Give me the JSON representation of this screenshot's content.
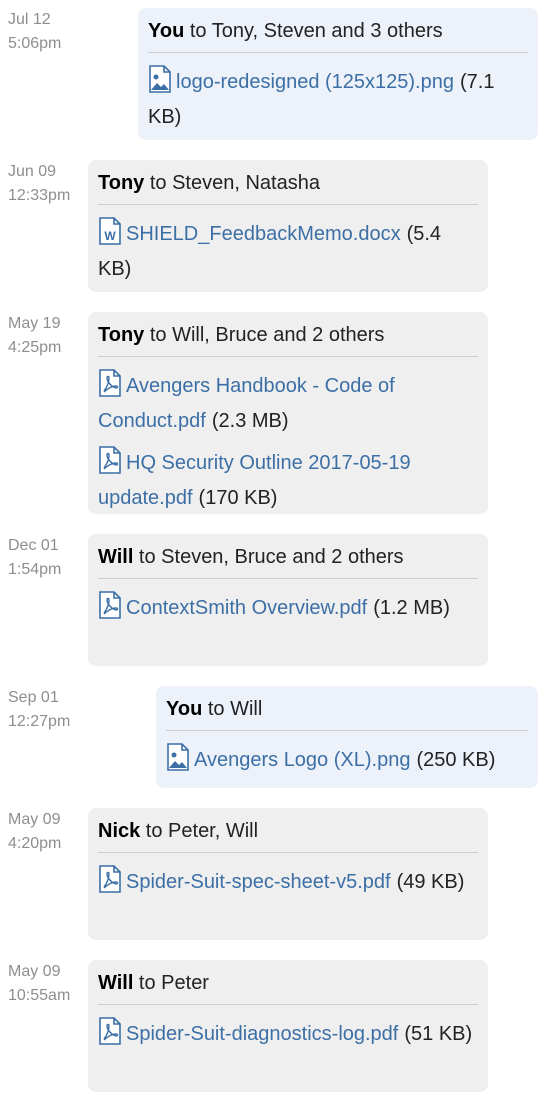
{
  "entries": [
    {
      "date": "Jul 12",
      "time": "5:06pm",
      "sender": "You",
      "recipients": " to Tony, Steven and 3 others",
      "mine": true,
      "files": [
        {
          "name": "logo-redesigned (125x125).png",
          "size": "(7.1 KB)",
          "icon": "image-file-icon"
        }
      ]
    },
    {
      "date": "Jun 09",
      "time": "12:33pm",
      "sender": "Tony",
      "recipients": " to Steven, Natasha",
      "mine": false,
      "files": [
        {
          "name": "SHIELD_FeedbackMemo.docx",
          "size": "(5.4 KB)",
          "icon": "word-file-icon"
        }
      ]
    },
    {
      "date": "May 19",
      "time": "4:25pm",
      "sender": "Tony",
      "recipients": " to Will, Bruce and 2 others",
      "mine": false,
      "files": [
        {
          "name": "Avengers Handbook - Code of Conduct.pdf",
          "size": "(2.3 MB)",
          "icon": "pdf-file-icon"
        },
        {
          "name": "HQ Security Outline 2017-05-19 update.pdf",
          "size": "(170 KB)",
          "icon": "pdf-file-icon"
        }
      ]
    },
    {
      "date": "Dec 01",
      "time": "1:54pm",
      "sender": "Will",
      "recipients": " to Steven, Bruce and 2 others",
      "mine": false,
      "files": [
        {
          "name": "ContextSmith Overview.pdf",
          "size": "(1.2 MB)",
          "icon": "pdf-file-icon"
        }
      ]
    },
    {
      "date": "Sep 01",
      "time": "12:27pm",
      "sender": "You",
      "recipients": " to Will",
      "mine": true,
      "files": [
        {
          "name": "Avengers Logo (XL).png",
          "size": "(250 KB)",
          "icon": "image-file-icon"
        }
      ]
    },
    {
      "date": "May 09",
      "time": "4:20pm",
      "sender": "Nick",
      "recipients": " to Peter, Will",
      "mine": false,
      "files": [
        {
          "name": "Spider-Suit-spec-sheet-v5.pdf",
          "size": "(49 KB)",
          "icon": "pdf-file-icon"
        }
      ]
    },
    {
      "date": "May 09",
      "time": "10:55am",
      "sender": "Will",
      "recipients": " to Peter",
      "mine": false,
      "files": [
        {
          "name": "Spider-Suit-diagnostics-log.pdf",
          "size": "(51 KB)",
          "icon": "pdf-file-icon"
        }
      ]
    }
  ]
}
